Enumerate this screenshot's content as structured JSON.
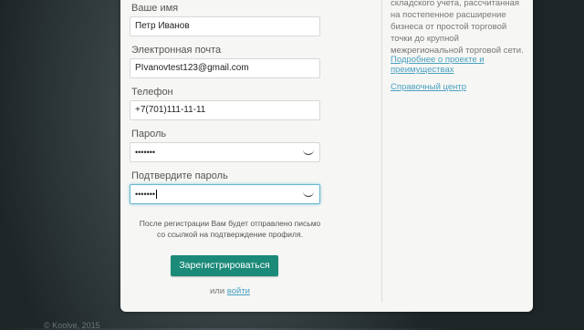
{
  "form": {
    "name_label": "Ваше имя",
    "name_value": "Петр Иванов",
    "email_label": "Электронная почта",
    "email_value": "PIvanovtest123@gmail.com",
    "phone_label": "Телефон",
    "phone_value": "+7(701)111-11-11",
    "password_label": "Пароль",
    "password_value": "•••••••",
    "confirm_label": "Подтвердите пароль",
    "confirm_value": "•••••••",
    "note_line1": "После регистрации Вам будет отправлено письмо",
    "note_line2": "со ссылкой на подтверждение профиля.",
    "submit_label": "Зарегистрироваться",
    "or_text": "или",
    "login_link": "войти"
  },
  "sidebar": {
    "description_lines": [
      "складского учета, рассчитанная",
      "на постепенное расширение",
      "бизнеса от простой торговой",
      "точки до крупной",
      "межрегиональной торговой сети."
    ],
    "about_link_line1": "Подробнее о проекте и",
    "about_link_line2": "преимуществах",
    "help_link": "Справочный центр"
  },
  "footer": {
    "copyright": "© Koolve, 2015"
  },
  "colors": {
    "accent_button": "#1c8a79",
    "link": "#4aa1c2",
    "focus_border": "#67b6d1"
  }
}
